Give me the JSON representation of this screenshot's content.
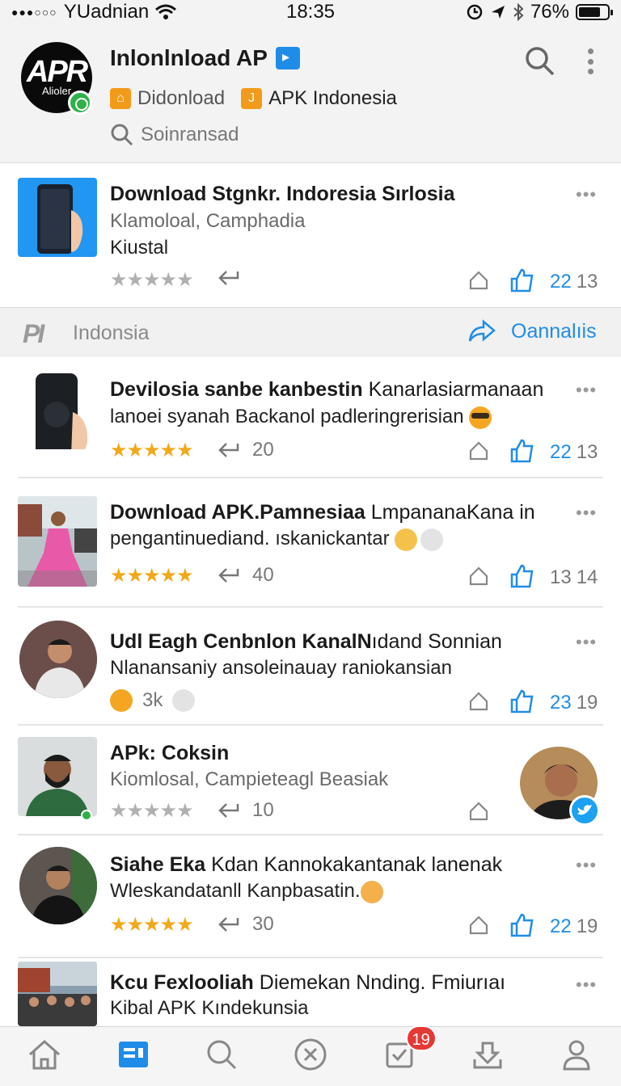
{
  "status_bar": {
    "carrier": "YUadnian",
    "time": "18:35",
    "battery": "76%",
    "battery_level": 0.76
  },
  "header": {
    "logo_text": "APR",
    "logo_subtext": "Alioler",
    "title": "Inlonlnload AP",
    "links": [
      {
        "label": "Didonload",
        "icon": "download-box-icon"
      },
      {
        "label": "APK Indonesia",
        "icon": "bookmark-box-icon"
      }
    ],
    "search_placeholder": "Soinransad"
  },
  "posts": [
    {
      "title_bold": "Download Stgnkr. Indoresia Sırlosia",
      "title_rest": "",
      "line2": "Klamoloal, Camphadia",
      "line3": "Kiustal",
      "stars": "★★★★★",
      "star_color": "grey",
      "reshare_count": "",
      "count_a": "22",
      "count_b": "13"
    },
    {
      "title_bold": "Devilosia sanbe kanbestin",
      "title_rest": " Kanarlasiarmanaan",
      "line2": "lanoei syanah Backanol padleringrerisian",
      "stars": "★★★★★",
      "star_color": "gold",
      "reshare_count": "20",
      "count_a": "22",
      "count_b": "13"
    },
    {
      "title_bold": "Download APK.Pamnesiaa",
      "title_rest": " LmpananaKana in",
      "line2": "pengantinuediand. ıskanickantar",
      "stars": "★★★★★",
      "star_color": "gold",
      "reshare_count": "40",
      "count_a": "13",
      "count_b": "14"
    },
    {
      "title_bold": "Udl Eagh Cenbnlon KanalN",
      "title_rest": "ıdand Sonnian",
      "line2": "Nlanansaniy ansoleinauay raniokansian",
      "reaction_count": "3k",
      "count_a": "23",
      "count_b": "19"
    },
    {
      "title_bold": "APk: Coksin",
      "title_rest": "",
      "line2": "Kiomlosal, Campieteagl Beasiak",
      "stars": "★★★★★",
      "star_color": "grey",
      "reshare_count": "10"
    },
    {
      "title_bold": "Siahe Eka",
      "title_rest": " Kdan Kannokakantanak lanenak",
      "line2": "Wleskandatanll Kanpbasatin.",
      "stars": "★★★★★",
      "star_color": "gold",
      "reshare_count": "30",
      "count_a": "22",
      "count_b": "19"
    },
    {
      "title_bold": "Kcu Fexlooliah",
      "title_rest": " Diemekan Nnding. Fmiurıaı",
      "line2": "Kibal APK Kındekunsia"
    }
  ],
  "section": {
    "logo": "PI",
    "label": "Indonsia",
    "link": "Oannalıis"
  },
  "bottom_nav": {
    "badge": "19",
    "items": [
      "home-icon",
      "news-icon",
      "search-icon",
      "close-circle-icon",
      "inbox-check-icon",
      "download-icon",
      "profile-icon"
    ]
  },
  "colors": {
    "accent": "#1f8de8",
    "star_gold": "#f2a81a",
    "badge_red": "#e53935"
  }
}
